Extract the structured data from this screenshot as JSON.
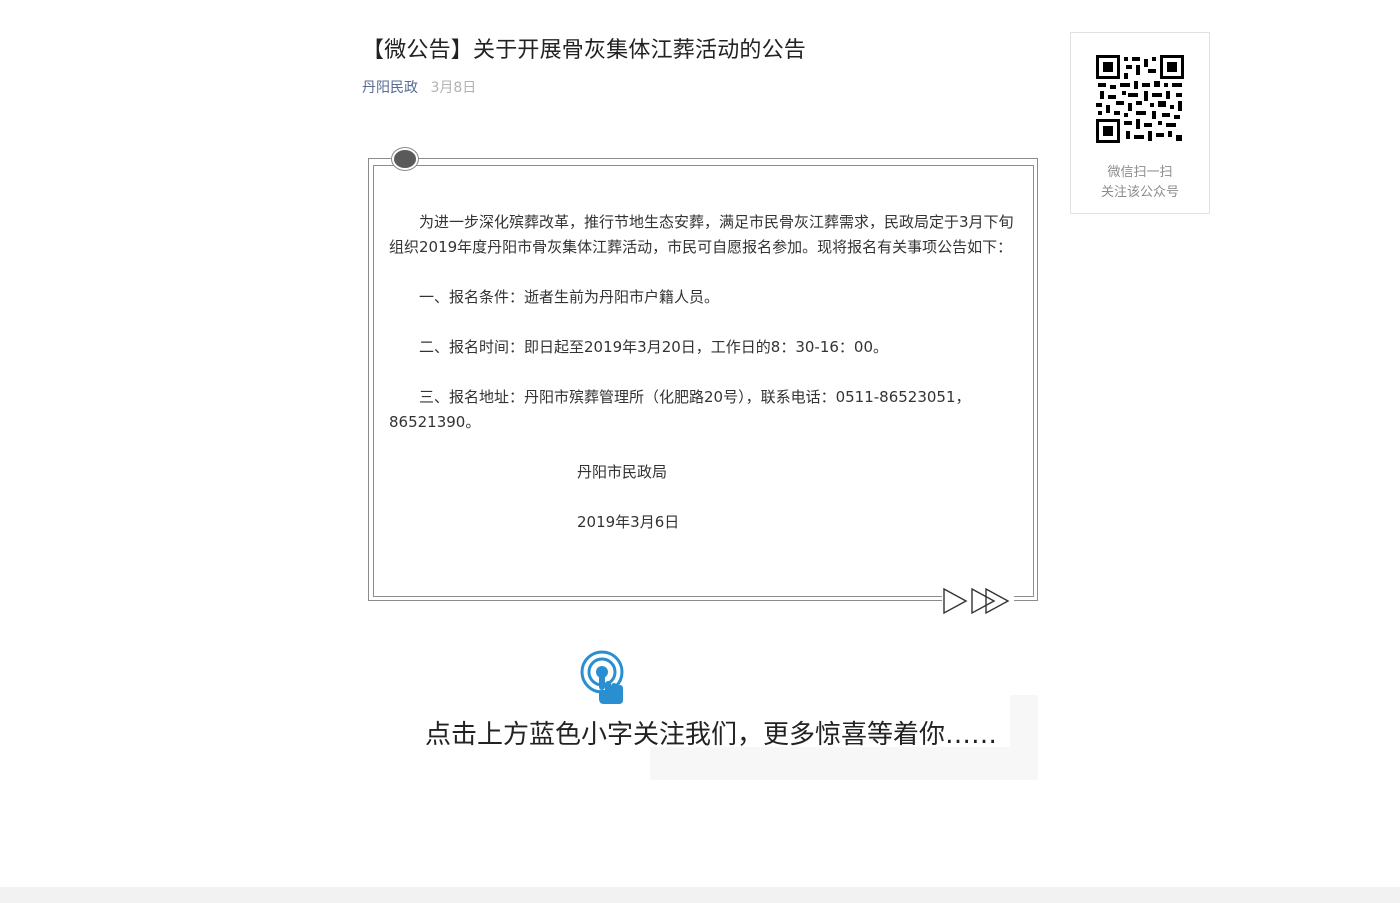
{
  "article": {
    "title": "【微公告】关于开展骨灰集体江葬活动的公告",
    "author": "丹阳民政",
    "date": "3月8日",
    "paragraphs": [
      "为进一步深化殡葬改革，推行节地生态安葬，满足市民骨灰江葬需求，民政局定于3月下旬组织2019年度丹阳市骨灰集体江葬活动，市民可自愿报名参加。现将报名有关事项公告如下：",
      "一、报名条件：逝者生前为丹阳市户籍人员。",
      "二、报名时间：即日起至2019年3月20日，工作日的8：30-16：00。",
      "三、报名地址：丹阳市殡葬管理所（化肥路20号），联系电话：0511-86523051，86521390。"
    ],
    "signature": "丹阳市民政局",
    "signature_date": "2019年3月6日"
  },
  "banner": {
    "text": "点击上方蓝色小字关注我们，更多惊喜等着你……",
    "icon": "tap-finger-icon",
    "icon_color": "#2a8fd0"
  },
  "qr_card": {
    "line1": "微信扫一扫",
    "line2": "关注该公众号",
    "icon": "qr-code-icon"
  },
  "colors": {
    "author_link": "#576b95",
    "date": "#b2b2b2",
    "frame": "#8c8c8c"
  }
}
